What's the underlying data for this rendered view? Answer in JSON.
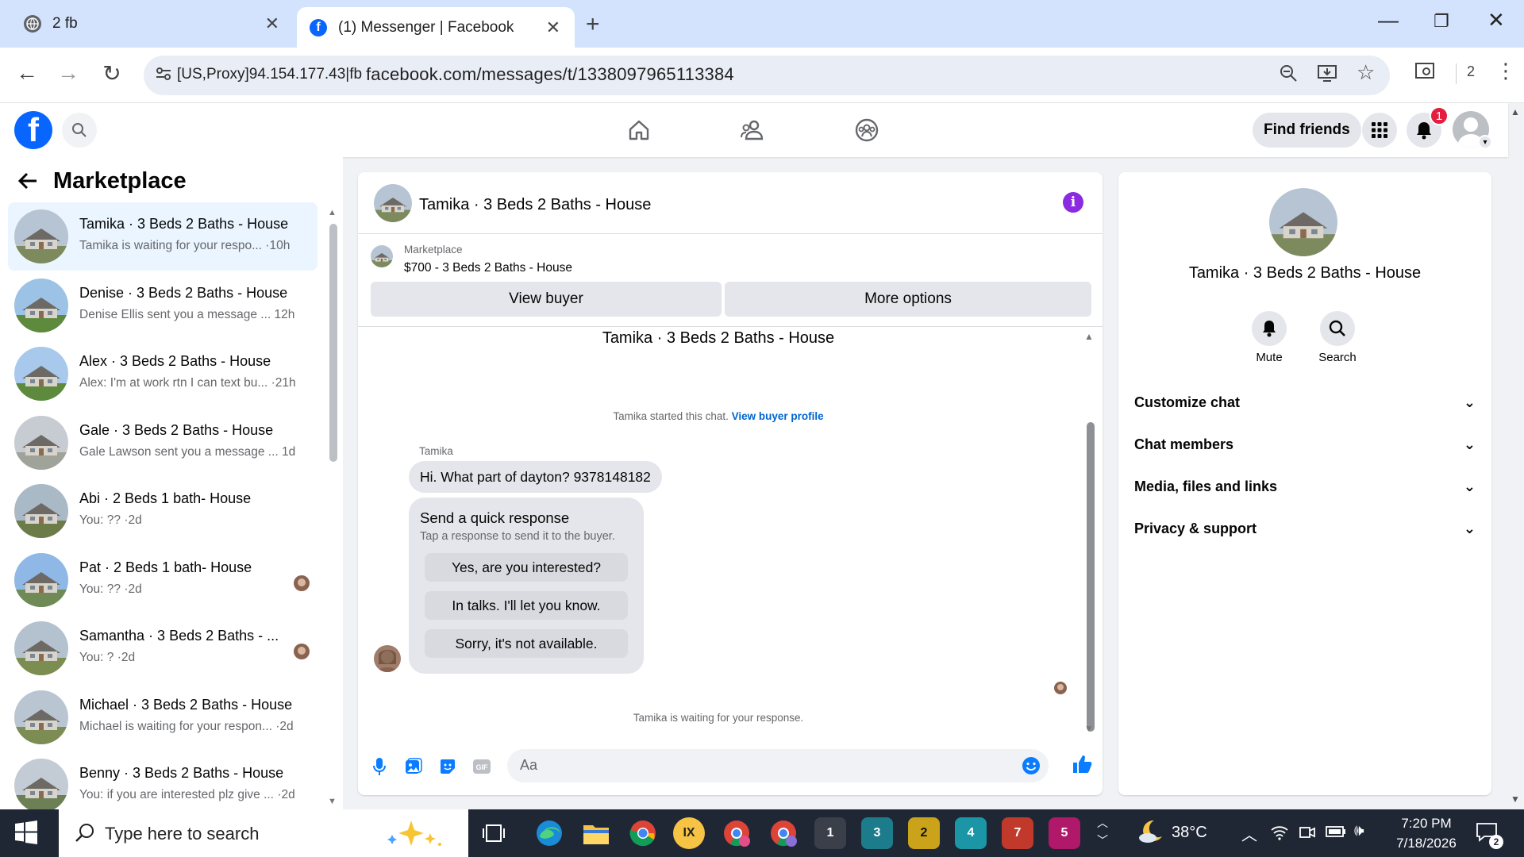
{
  "browser": {
    "tabs": [
      {
        "title": "2 fb",
        "active": false
      },
      {
        "title": "(1) Messenger | Facebook",
        "active": true
      }
    ],
    "new_tab_label": "+",
    "proxy_label": "[US,Proxy]94.154.177.43|fb",
    "url": "facebook.com/messages/t/1338097965113384",
    "profile_count": "2"
  },
  "fb_header": {
    "logo_letter": "f",
    "find_friends_label": "Find friends",
    "notification_count": "1"
  },
  "sidebar": {
    "title": "Marketplace",
    "conversations": [
      {
        "name": "Tamika · 3 Beds 2 Baths - House",
        "preview": "Tamika is waiting for your respo... ·10h",
        "selected": true
      },
      {
        "name": "Denise · 3 Beds 2 Baths - House",
        "preview": "Denise Ellis sent you a message ... 12h",
        "selected": false
      },
      {
        "name": "Alex · 3 Beds 2 Baths - House",
        "preview": "Alex: I'm at work rtn I can text bu... ·21h",
        "selected": false
      },
      {
        "name": "Gale · 3 Beds 2 Baths - House",
        "preview": "Gale Lawson sent you a message ... 1d",
        "selected": false
      },
      {
        "name": "Abi · 2 Beds 1 bath- House",
        "preview": "You: ?? ·2d",
        "selected": false
      },
      {
        "name": "Pat · 2 Beds 1 bath- House",
        "preview": "You: ?? ·2d",
        "selected": false
      },
      {
        "name": "Samantha · 3 Beds 2 Baths - ...",
        "preview": "You: ? ·2d",
        "selected": false
      },
      {
        "name": "Michael · 3 Beds 2 Baths - House",
        "preview": "Michael is waiting for your respon... ·2d",
        "selected": false
      },
      {
        "name": "Benny · 3 Beds 2 Baths - House",
        "preview": "You: if you are interested plz give ... ·2d",
        "selected": false
      }
    ]
  },
  "chat": {
    "header_name": "Tamika · 3 Beds 2 Baths - House",
    "listing_label": "Marketplace",
    "listing_title": "$700 - 3 Beds 2 Baths - House",
    "view_buyer_label": "View buyer",
    "more_options_label": "More options",
    "conversation_title": "Tamika · 3 Beds 2 Baths - House",
    "started_text": "Tamika started this chat.",
    "view_profile_link": "View buyer profile",
    "sender_name": "Tamika",
    "message": "Hi. What part of dayton? 9378148182",
    "quick_response_title": "Send a quick response",
    "quick_response_subtitle": "Tap a response to send it to the buyer.",
    "quick_responses": [
      "Yes, are you interested?",
      "In talks. I'll let you know.",
      "Sorry, it's not available."
    ],
    "waiting_text": "Tamika is waiting for your response.",
    "input_placeholder": "Aa"
  },
  "info_panel": {
    "name": "Tamika · 3 Beds 2 Baths - House",
    "mute_label": "Mute",
    "search_label": "Search",
    "sections": [
      "Customize chat",
      "Chat members",
      "Media, files and links",
      "Privacy & support"
    ]
  },
  "taskbar": {
    "search_placeholder": "Type here to search",
    "app_badges": [
      "1",
      "3",
      "2",
      "4",
      "7",
      "5"
    ],
    "temperature": "38°C",
    "time": "7:20 PM",
    "date": "7/18/2026",
    "notification_count": "2"
  },
  "colors": {
    "fb_blue": "#0866ff",
    "messenger_accent": "#0a7cff",
    "info_purple": "#8a2be2",
    "selected_bg": "#ebf5ff",
    "taskbar": "#1f2634"
  }
}
